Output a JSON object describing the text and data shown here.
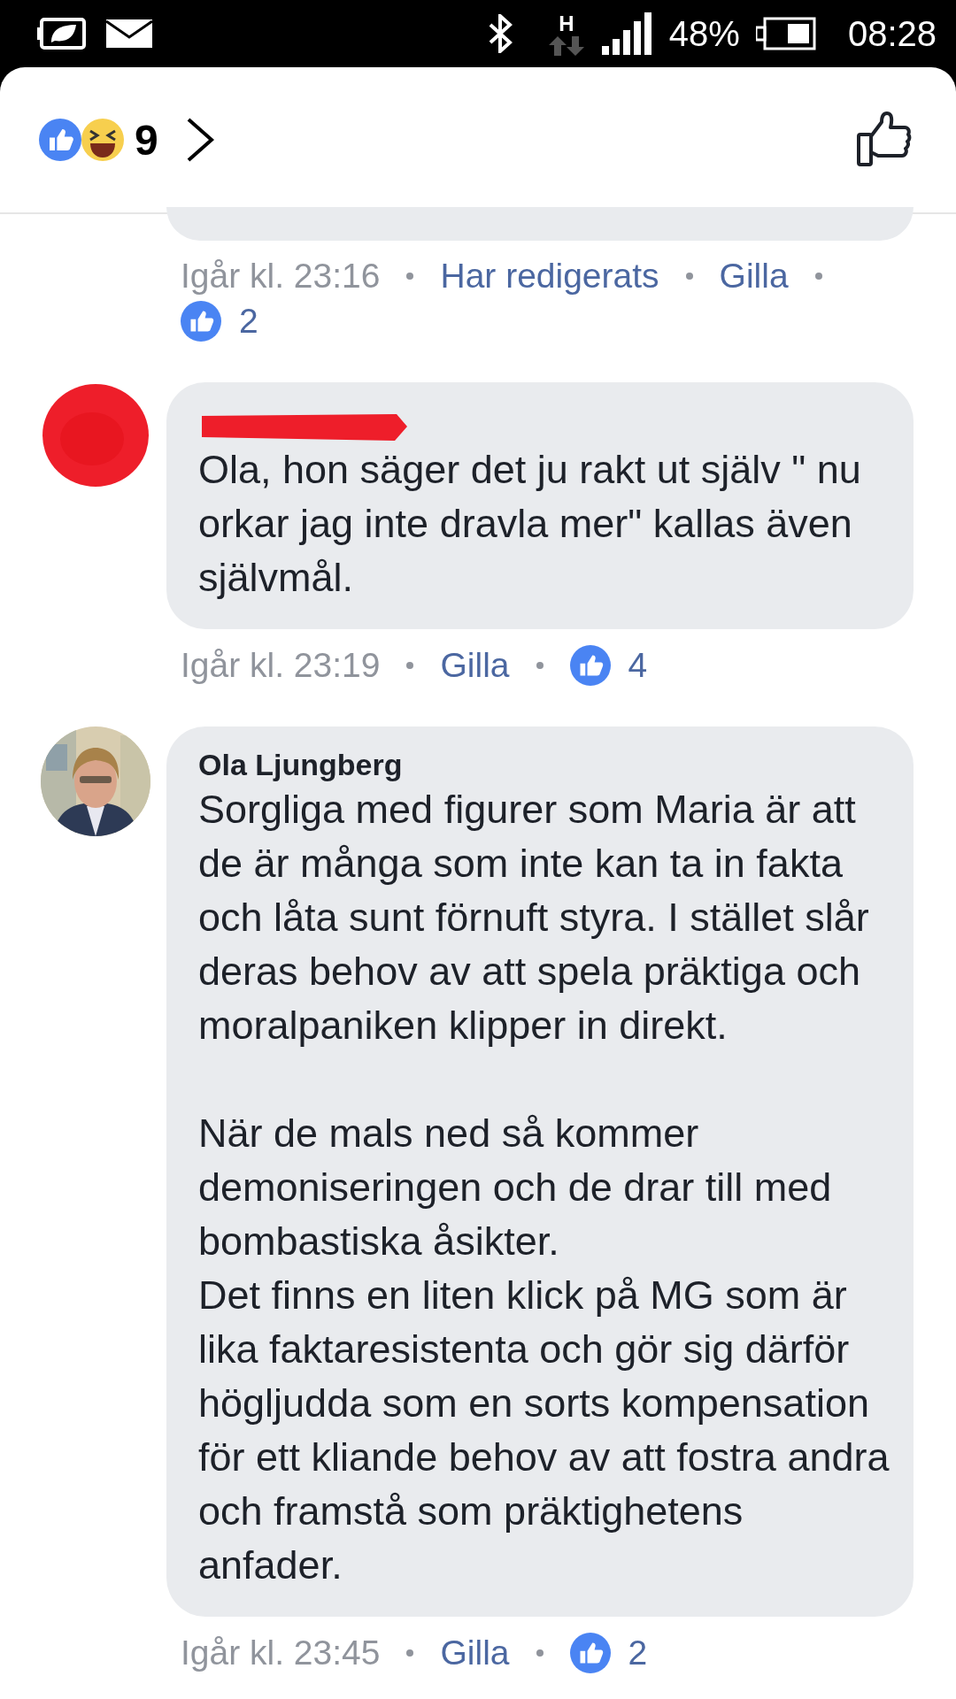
{
  "status_bar": {
    "network": "H",
    "battery": "48%",
    "time": "08:28"
  },
  "header": {
    "reaction_count": "9"
  },
  "comments": [
    {
      "kind": "cut",
      "time": "Igår kl. 23:16",
      "edited": "Har redigerats",
      "like": "Gilla",
      "likes": "2"
    },
    {
      "kind": "redacted",
      "text": "Ola, hon säger det ju rakt ut själv \" nu orkar jag inte dravla mer\" kallas även självmål.",
      "time": "Igår kl. 23:19",
      "like": "Gilla",
      "likes": "4"
    },
    {
      "kind": "named",
      "author": "Ola Ljungberg",
      "text": "Sorgliga med figurer som Maria är att de är många som inte kan ta in fakta och låta sunt förnuft styra. I stället slår deras behov av att spela präktiga och moralpaniken klipper in direkt.\n\nNär de mals ned så kommer demoniseringen och de drar till med bombastiska åsikter.\nDet finns en liten klick på MG som är lika faktaresistenta och gör sig därför högljudda som en sorts kompensation för ett kliande behov av att fostra andra och framstå som präktighetens anfader.",
      "time": "Igår kl. 23:45",
      "like": "Gilla",
      "likes": "2"
    }
  ]
}
